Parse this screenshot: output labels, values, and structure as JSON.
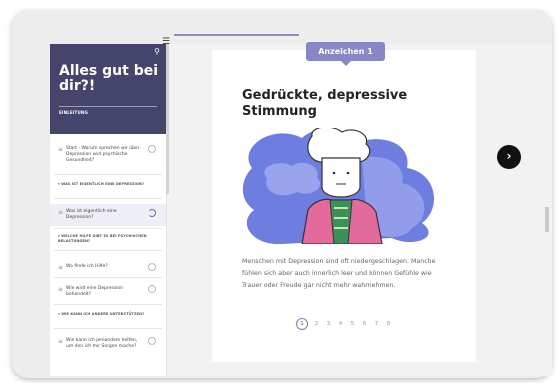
{
  "sidebar": {
    "title": "Alles gut bei dir?!",
    "subtitle": "EINLEITUNG",
    "items": [
      {
        "label": "Start - Warum sprechen wir über Depression und psychische Gesundheit?",
        "type": "item"
      },
      {
        "label": "WAS IST EIGENTLICH EINE DEPRESSION?",
        "type": "section"
      },
      {
        "label": "Was ist eigentlich eine Depression?",
        "type": "item"
      },
      {
        "label": "WELCHE HILFE GIBT ES BEI PSYCHISCHEN BELASTUNGEN?",
        "type": "section"
      },
      {
        "label": "Wo finde ich Hilfe?",
        "type": "item"
      },
      {
        "label": "Wie wird eine Depression behandelt?",
        "type": "item"
      },
      {
        "label": "WIE KANN ICH ANDERE UNTERSTÜTZEN?",
        "type": "section"
      },
      {
        "label": "Wie kann ich jemandem helfen, um den ich mir Sorgen mache?",
        "type": "item"
      }
    ]
  },
  "badge": "Anzeichen 1",
  "card": {
    "title": "Gedrückte, depressive Stimmung",
    "body": "Menschen mit Depression sind oft niedergeschlagen. Manche fühlen sich aber auch innerlich leer und können Gefühle wie Trauer oder Freude gar nicht mehr wahrnehmen."
  },
  "pager": {
    "pages": [
      "1",
      "2",
      "3",
      "4",
      "5",
      "6",
      "7",
      "8"
    ],
    "current": "1"
  },
  "icons": {
    "search": "search-icon",
    "menu": "menu-icon",
    "next": "chevron-right-icon"
  },
  "colors": {
    "sidebar_header": "#45456b",
    "accent": "#8787c8"
  }
}
